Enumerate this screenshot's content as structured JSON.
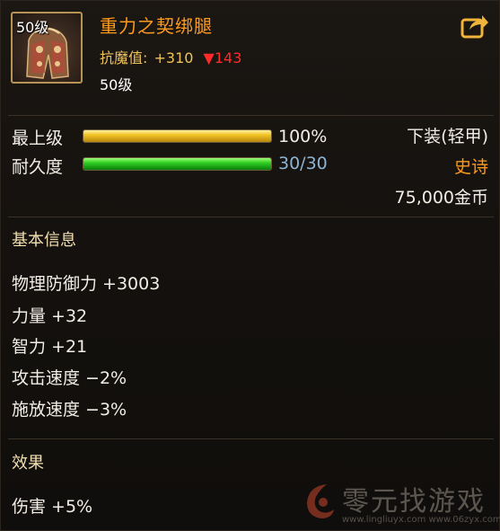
{
  "item": {
    "level_tag": "50级",
    "name": "重力之契绑腿",
    "resist_label": "抗魔值:",
    "resist_plus": "+310",
    "resist_down": "▼143",
    "level_line": "50级"
  },
  "stats": {
    "grade_label": "最上级",
    "grade_value": "100%",
    "grade_fraction": 1.0,
    "durability_label": "耐久度",
    "durability_value": "30/30",
    "durability_fraction": 1.0,
    "slot_type": "下装(轻甲)",
    "rarity": "史诗",
    "price": "75,000金币"
  },
  "basic_info": {
    "title": "基本信息",
    "attributes": [
      "物理防御力 +3003",
      "力量 +32",
      "智力 +21",
      "攻击速度 −2%",
      "施放速度 −3%"
    ]
  },
  "effects": {
    "title": "效果",
    "lines": [
      "伤害 +5%"
    ]
  },
  "watermark": {
    "text": "零元找游戏",
    "url": "www.lingliuyx.com  www.06zyx.com"
  },
  "colors": {
    "item_name": "#ff9a1e",
    "rarity_epic": "#ff9a1e",
    "resist_label": "#f0c35a",
    "resist_down": "#ff2a2a",
    "durability_value": "#8fb4d6",
    "grade_bar": "#f2c325",
    "durability_bar": "#2fcf21"
  },
  "icons": [
    "item-icon-leggings",
    "share-icon"
  ]
}
